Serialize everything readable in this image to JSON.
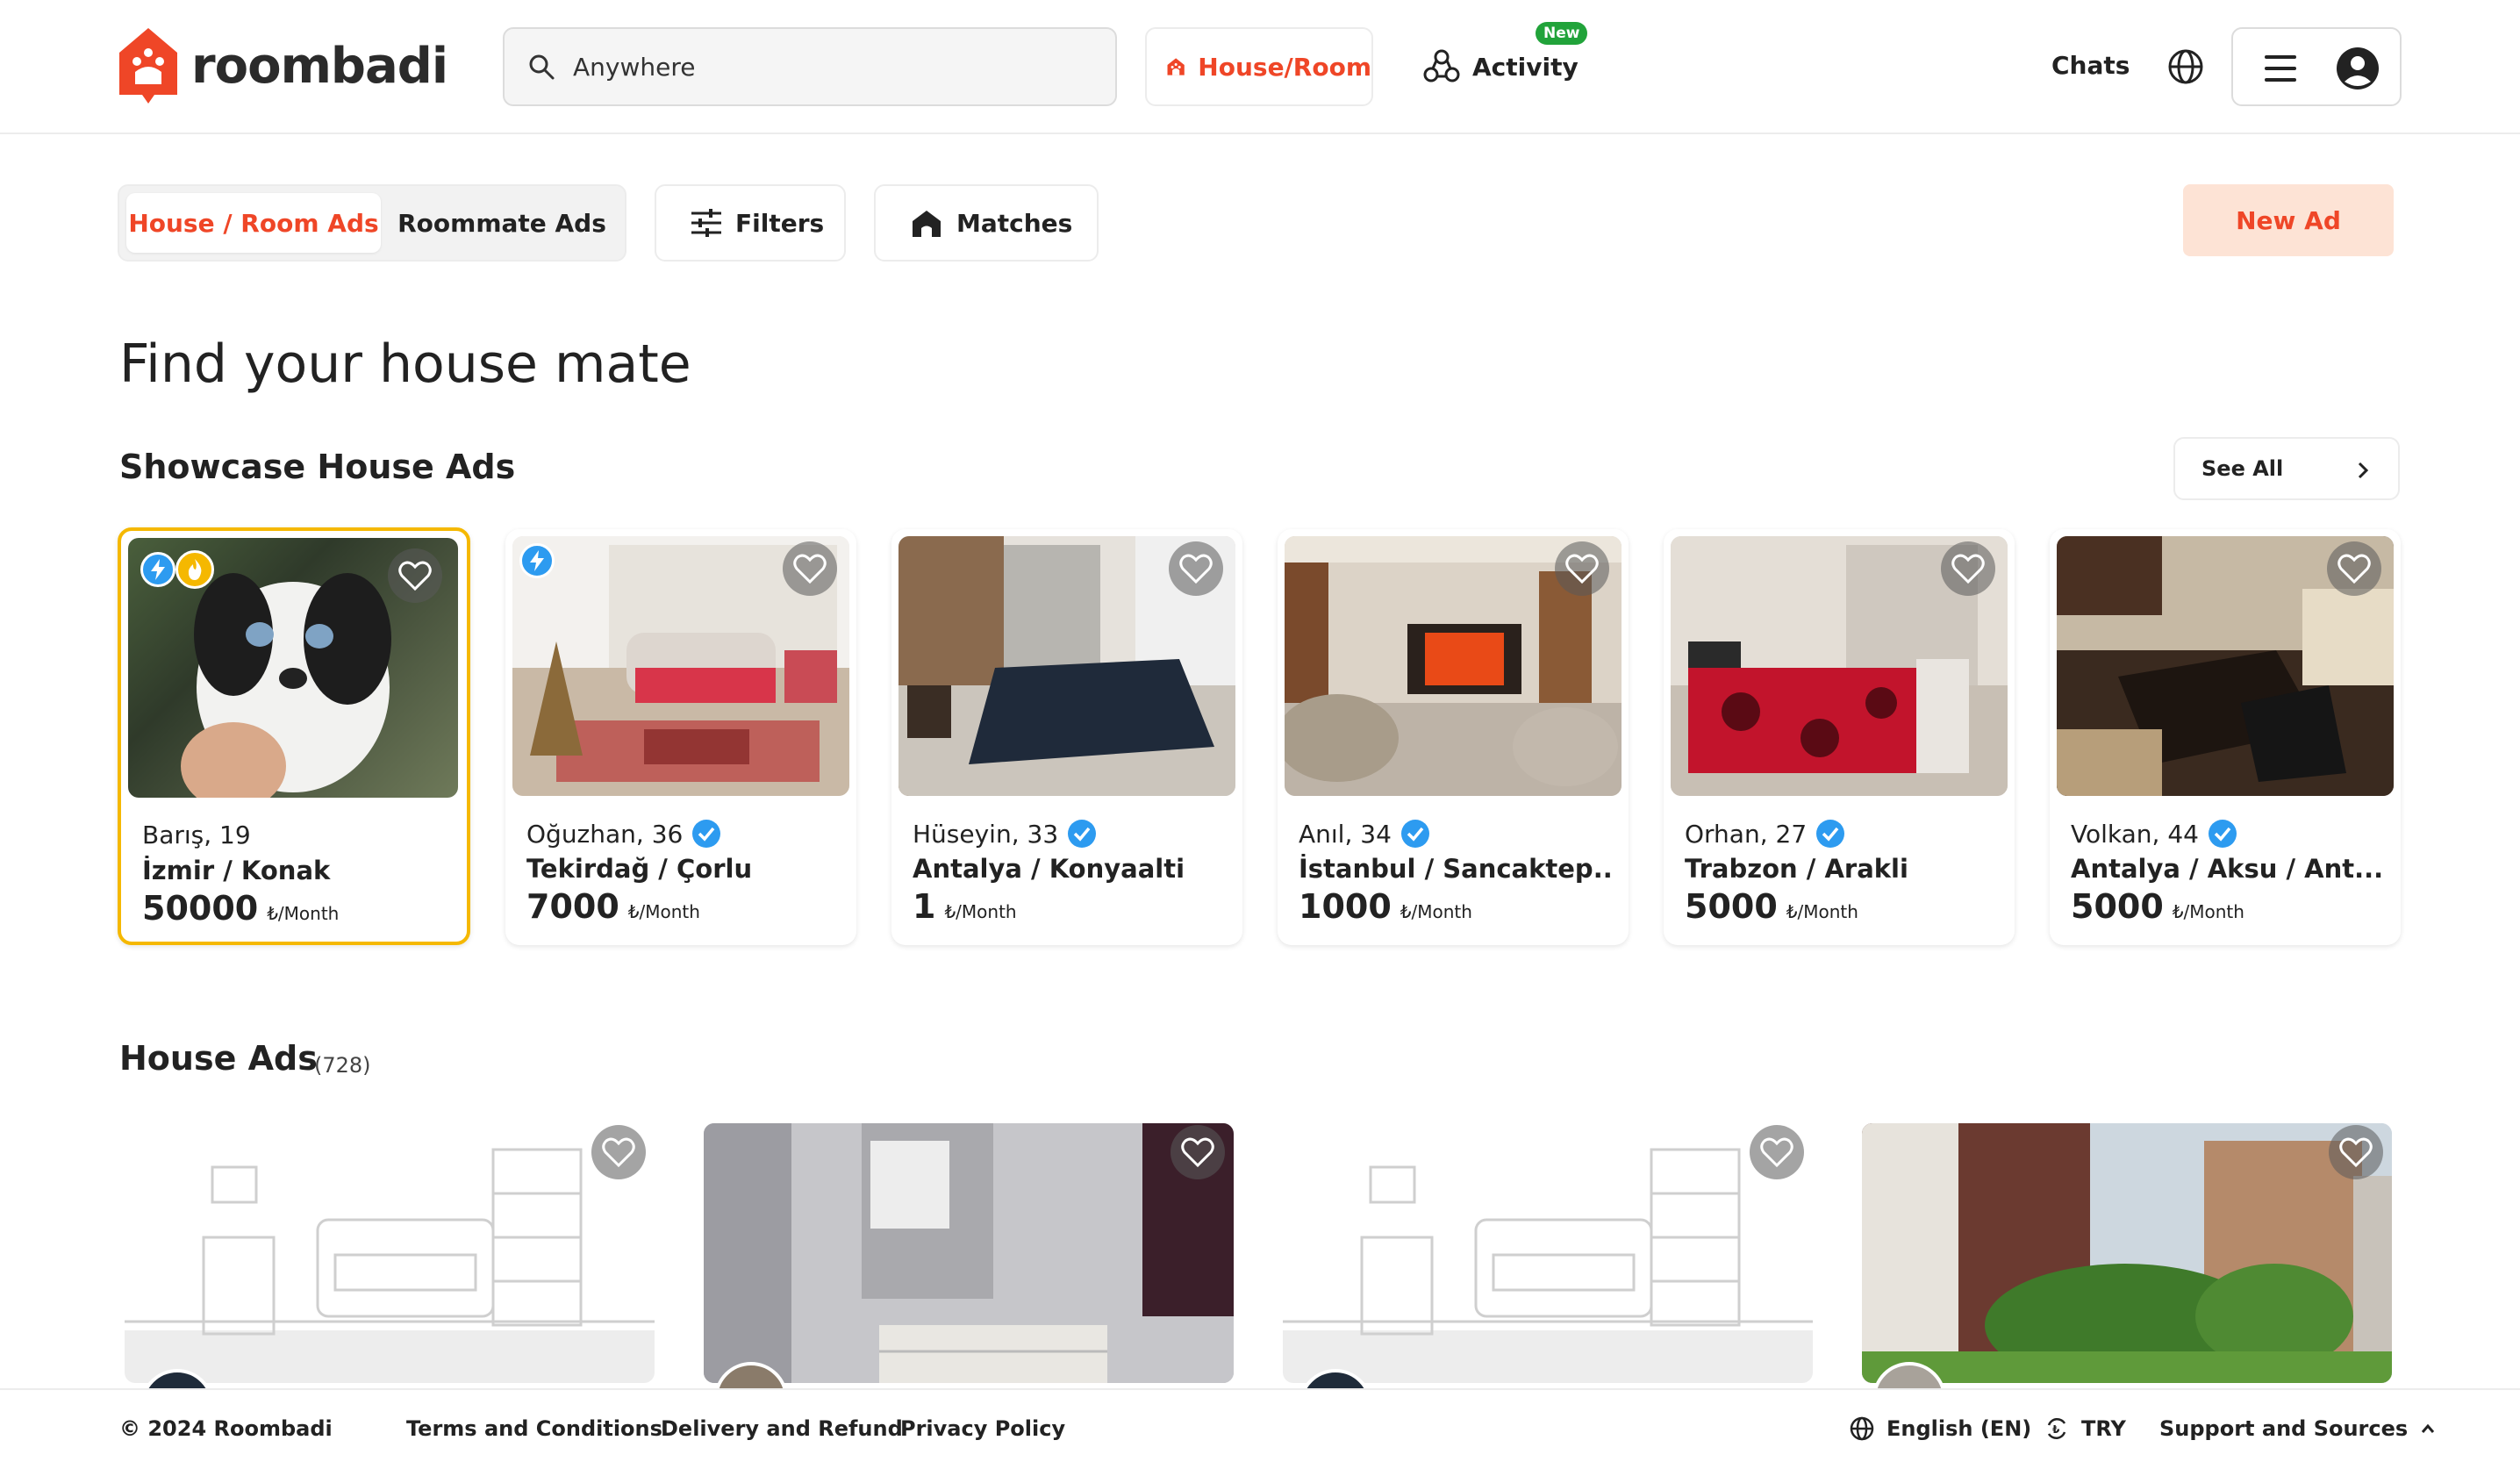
{
  "header": {
    "brand": "roombadi",
    "search_placeholder": "Anywhere",
    "house_room_label": "House/Room",
    "activity_label": "Activity",
    "activity_badge": "New",
    "chats_label": "Chats"
  },
  "toolbar": {
    "tab_house_room": "House / Room Ads",
    "tab_roommate": "Roommate Ads",
    "filters_label": "Filters",
    "matches_label": "Matches",
    "new_ad_label": "New Ad"
  },
  "page_title": "Find your house mate",
  "showcase": {
    "title": "Showcase House Ads",
    "see_all": "See All",
    "cards": [
      {
        "name": "Barış, 19",
        "location": "İzmir / Konak",
        "price": "50000",
        "period": "₺/Month"
      },
      {
        "name": "Oğuzhan, 36",
        "location": "Tekirdağ / Çorlu",
        "price": "7000",
        "period": "₺/Month"
      },
      {
        "name": "Hüseyin, 33",
        "location": "Antalya / Konyaalti",
        "price": "1",
        "period": "₺/Month"
      },
      {
        "name": "Anıl, 34",
        "location": "İstanbul / Sancaktep...",
        "price": "1000",
        "period": "₺/Month"
      },
      {
        "name": "Orhan, 27",
        "location": "Trabzon / Arakli",
        "price": "5000",
        "period": "₺/Month"
      },
      {
        "name": "Volkan, 44",
        "location": "Antalya / Aksu / Ant...",
        "price": "5000",
        "period": "₺/Month"
      }
    ]
  },
  "house_ads": {
    "title": "House Ads",
    "count": "(728)"
  },
  "footer": {
    "copyright": "© 2024 Roombadi",
    "terms": "Terms and Conditions",
    "delivery": "Delivery and Refund",
    "privacy": "Privacy Policy",
    "language": "English (EN)",
    "currency": "TRY",
    "support": "Support and Sources"
  },
  "colors": {
    "brand": "#ef4627",
    "featured_border": "#f5b800",
    "new_ad_bg": "#fde3d5",
    "verified": "#2d9bf0",
    "new_badge": "#21a33a"
  }
}
